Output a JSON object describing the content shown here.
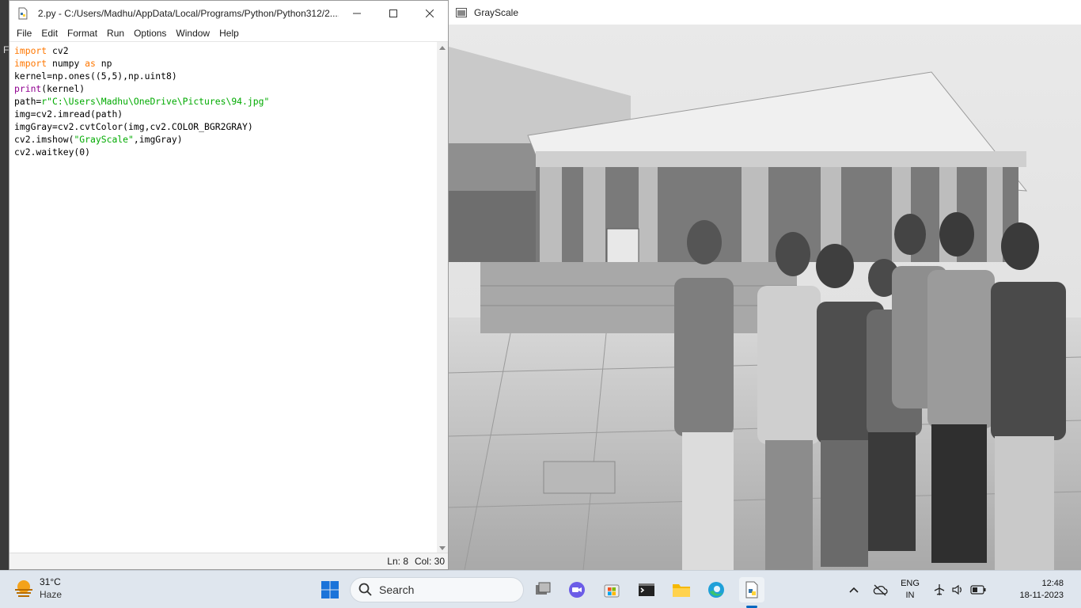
{
  "desktop": {
    "edge_letter": "F"
  },
  "idle": {
    "title": "2.py - C:/Users/Madhu/AppData/Local/Programs/Python/Python312/2....",
    "menu": [
      "File",
      "Edit",
      "Format",
      "Run",
      "Options",
      "Window",
      "Help"
    ],
    "status": {
      "line": "Ln: 8",
      "col": "Col: 30"
    },
    "code": [
      [
        {
          "t": "import",
          "c": "kw"
        },
        {
          "t": " cv2"
        }
      ],
      [
        {
          "t": "import",
          "c": "kw"
        },
        {
          "t": " numpy "
        },
        {
          "t": "as",
          "c": "kw"
        },
        {
          "t": " np"
        }
      ],
      [
        {
          "t": "kernel=np.ones((5,5),np.uint8)"
        }
      ],
      [
        {
          "t": "print",
          "c": "bi"
        },
        {
          "t": "(kernel)"
        }
      ],
      [
        {
          "t": "path="
        },
        {
          "t": "r\"C:\\Users\\Madhu\\OneDrive\\Pictures\\94.jpg\"",
          "c": "str"
        }
      ],
      [
        {
          "t": "img=cv2.imread(path)"
        }
      ],
      [
        {
          "t": "imgGray=cv2.cvtColor(img,cv2.COLOR_BGR2GRAY)"
        }
      ],
      [
        {
          "t": "cv2.imshow("
        },
        {
          "t": "\"GrayScale\"",
          "c": "str"
        },
        {
          "t": ",imgGray)"
        }
      ],
      [
        {
          "t": "cv2.waitkey(0)"
        }
      ]
    ]
  },
  "image_window": {
    "title": "GrayScale"
  },
  "taskbar": {
    "weather": {
      "temp": "31°C",
      "condition": "Haze",
      "icon": "sun-haze-icon"
    },
    "search_label": "Search",
    "pinned": [
      "windows-start-icon",
      "task-view-icon",
      "chat-app-icon",
      "store-icon",
      "terminal-icon",
      "file-explorer-icon",
      "edge-icon",
      "python-idle-icon"
    ],
    "tray": {
      "lang_top": "ENG",
      "lang_bottom": "IN"
    },
    "clock": {
      "time": "12:48",
      "date": "18-11-2023"
    },
    "colors": {
      "accent": "#0067c0",
      "keyword": "#ff7700",
      "builtin": "#900090",
      "string": "#00aa00"
    }
  }
}
